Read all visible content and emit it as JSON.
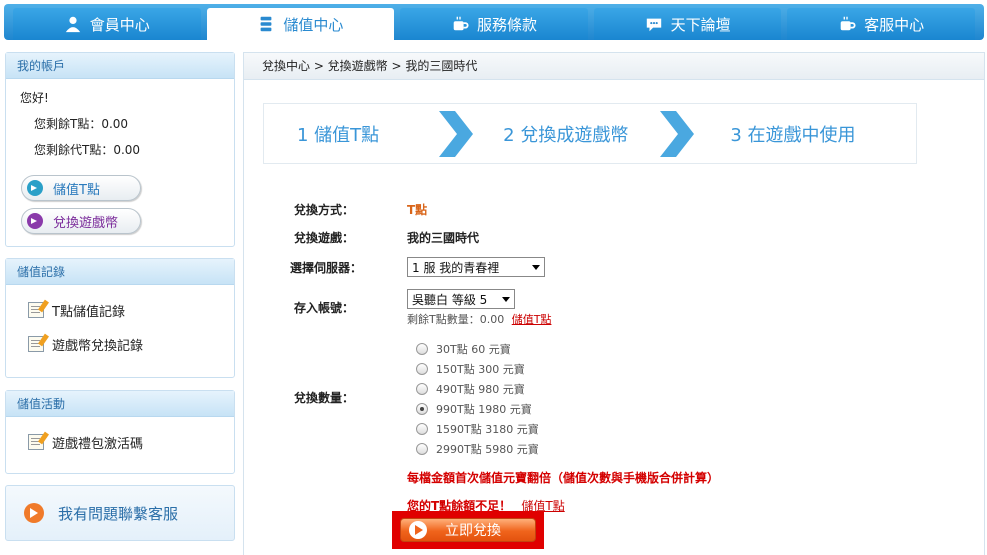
{
  "nav": {
    "tabs": [
      {
        "label": "會員中心",
        "icon": "user-icon"
      },
      {
        "label": "儲值中心",
        "icon": "database-icon",
        "active": true
      },
      {
        "label": "服務條款",
        "icon": "cup-icon"
      },
      {
        "label": "天下論壇",
        "icon": "chat-bubble-icon"
      },
      {
        "label": "客服中心",
        "icon": "cup-icon"
      }
    ]
  },
  "sidebar": {
    "account": {
      "title": "我的帳戶",
      "greeting": "您好!",
      "t_points": "您剩餘T點：0.00",
      "proxy_points": "您剩餘代T點：0.00",
      "topup_button": "儲值T點",
      "exchange_button": "兌換遊戲幣"
    },
    "records": {
      "title": "儲值記錄",
      "items": [
        "T點儲值記錄",
        "遊戲幣兌換記錄"
      ]
    },
    "events": {
      "title": "儲值活動",
      "items": [
        "遊戲禮包激活碼"
      ]
    },
    "help": "我有問題聯繫客服"
  },
  "breadcrumb": "兌換中心 > 兌換遊戲幣 > 我的三國時代",
  "steps": [
    "1 儲值T點",
    "2 兌換成遊戲幣",
    "3 在遊戲中使用"
  ],
  "form": {
    "method_label": "兌換方式：",
    "method_value": "T點",
    "game_label": "兌換遊戲：",
    "game_value": "我的三國時代",
    "server_label": "選擇伺服器：",
    "server_value": "1 服 我的青春裡",
    "account_label": "存入帳號：",
    "account_value": "吳聽白 等級 5",
    "remaining_text": "剩餘T點數量：0.00",
    "remaining_link": "儲值T點",
    "quantity_label": "兌換數量：",
    "options": [
      {
        "label": "30T點 60 元寶",
        "checked": false
      },
      {
        "label": "150T點 300 元寶",
        "checked": false
      },
      {
        "label": "490T點 980 元寶",
        "checked": false
      },
      {
        "label": "990T點 1980 元寶",
        "checked": true
      },
      {
        "label": "1590T點 3180 元寶",
        "checked": false
      },
      {
        "label": "2990T點 5980 元寶",
        "checked": false
      }
    ],
    "promo": "每檔金額首次儲值元寶翻倍（儲值次數與手機版合併計算）",
    "insufficient": "您的T點餘額不足！",
    "insufficient_link": "儲值T點",
    "submit": "立即兌換"
  },
  "colors": {
    "accent": "#2a8ad0",
    "warn": "#d40000",
    "button": "#f0641c"
  }
}
